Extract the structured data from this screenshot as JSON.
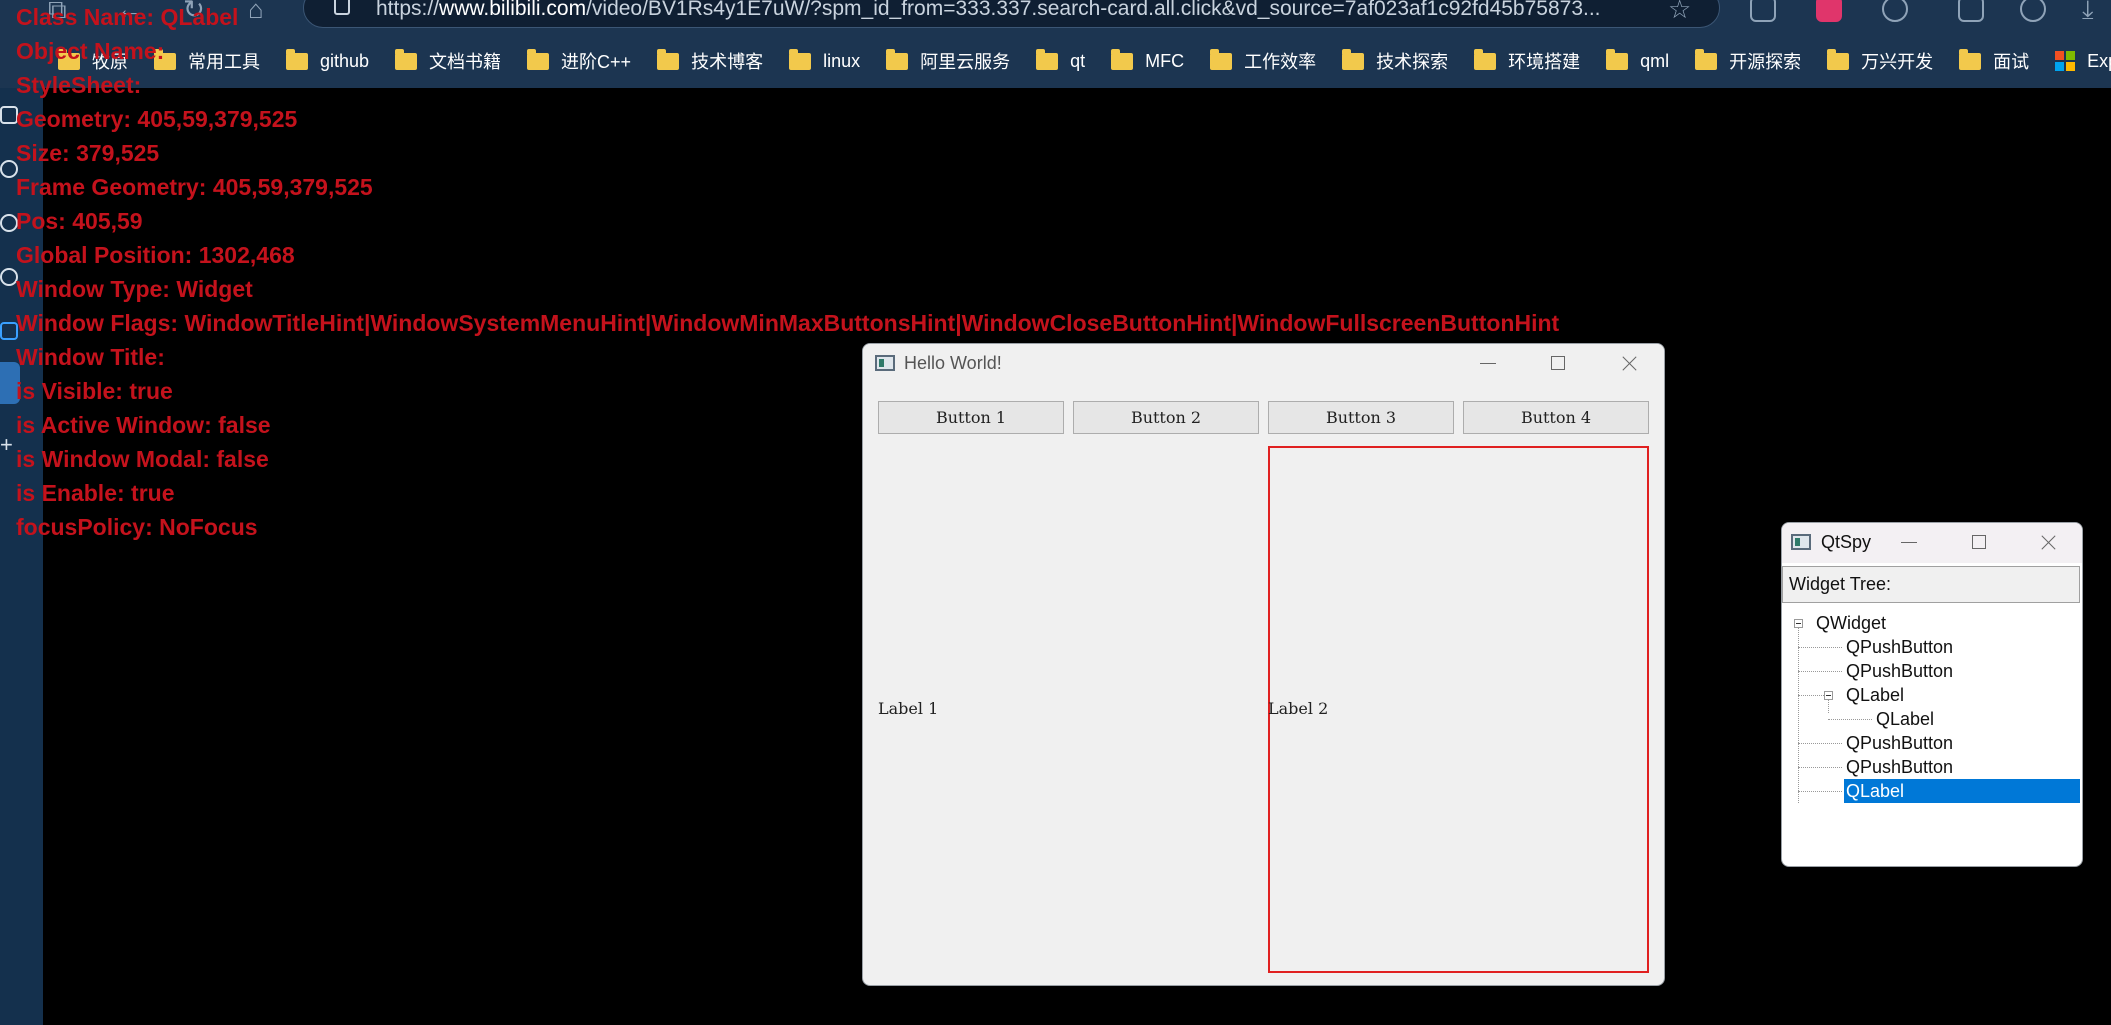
{
  "browser": {
    "url_prefix": "https://",
    "url_domain": "www.bilibili.com",
    "url_rest": "/video/BV1Rs4y1E7uW/?spm_id_from=333.337.search-card.all.click&vd_source=7af023af1c92fd45b75873...",
    "bookmarks": [
      "牧原",
      "常用工具",
      "github",
      "文档书籍",
      "进阶C++",
      "技术博客",
      "linux",
      "阿里云服务",
      "qt",
      "MFC",
      "工作效率",
      "技术探索",
      "环境搭建",
      "qml",
      "开源探索",
      "万兴开发",
      "面试"
    ],
    "explore_label": "Explore",
    "ms_colors": [
      "#f25022",
      "#7fba00",
      "#00a4ef",
      "#ffb900"
    ]
  },
  "inspector": {
    "lines": [
      "Class Name: QLabel",
      "Object Name:",
      "StyleSheet:",
      "Geometry: 405,59,379,525",
      "Size: 379,525",
      "Frame Geometry: 405,59,379,525",
      "Pos: 405,59",
      "Global Position: 1302,468",
      "Window Type: Widget",
      "Window Flags: WindowTitleHint|WindowSystemMenuHint|WindowMinMaxButtonsHint|WindowCloseButtonHint|WindowFullscreenButtonHint",
      "Window Title:",
      "is Visible: true",
      "is Active Window: false",
      "is Window Modal: false",
      "is Enable: true",
      "focusPolicy: NoFocus"
    ]
  },
  "hello_window": {
    "title": "Hello World!",
    "buttons": [
      "Button 1",
      "Button 2",
      "Button 3",
      "Button 4"
    ],
    "label1": "Label 1",
    "label2": "Label 2"
  },
  "qtspy": {
    "title": "QtSpy",
    "tree_header": "Widget Tree:",
    "tree": [
      "QWidget",
      "QPushButton",
      "QPushButton",
      "QLabel",
      "QLabel",
      "QPushButton",
      "QPushButton",
      "QLabel"
    ]
  }
}
